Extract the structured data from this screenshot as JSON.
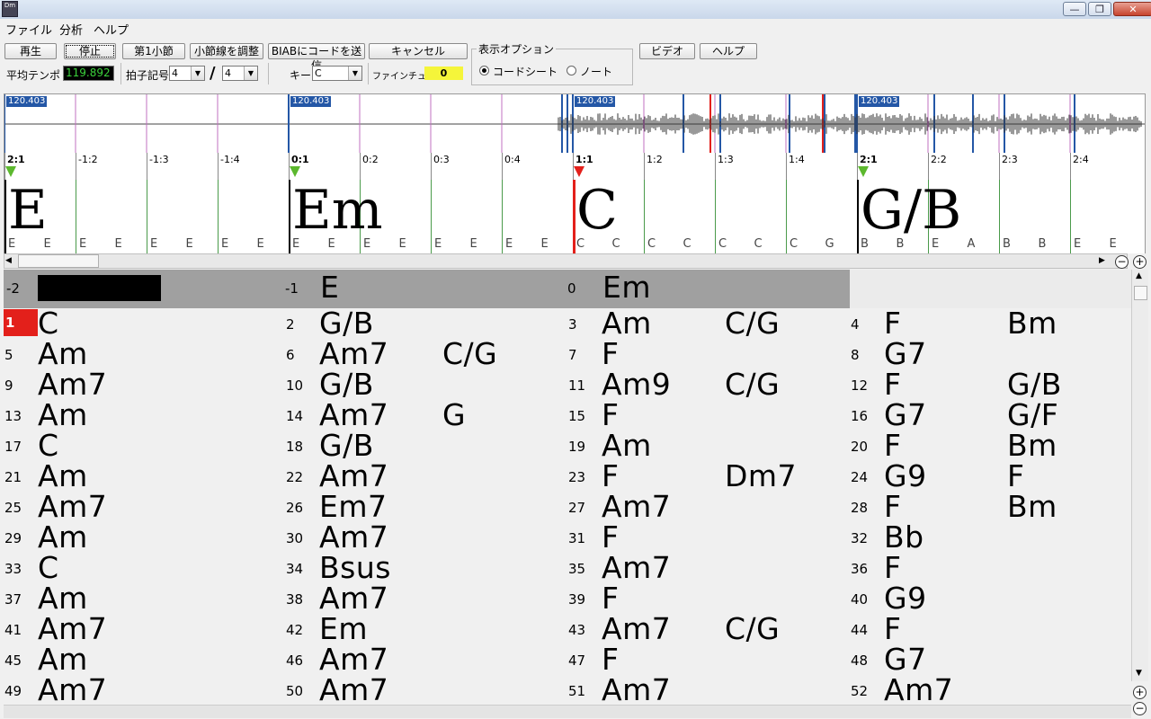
{
  "window": {
    "icon_label": "Dm",
    "minimize": "—",
    "restore": "❐",
    "close": "✕"
  },
  "menu": [
    "ファイル",
    "分析",
    "ヘルプ"
  ],
  "toolbar": {
    "play": "再生",
    "stop": "停止",
    "first_bar": "第1小節",
    "adjust_bars": "小節線を調整",
    "send_chords": "BIABにコードを送信",
    "cancel": "キャンセル",
    "video": "ビデオ",
    "help": "ヘルプ",
    "avg_tempo_label": "平均テンポ",
    "avg_tempo_value": "119.892",
    "time_sig_label": "拍子記号",
    "time_sig_num": "4",
    "time_sig_den": "4",
    "slash": "/",
    "key_label": "キー",
    "key_value": "C",
    "finetune_label": "ファインチューン",
    "finetune_value": "0",
    "display_options_title": "表示オプション",
    "opt_chordsheet": "コードシート",
    "opt_notes": "ノート"
  },
  "waveform": {
    "tempo_tags": [
      "120.403",
      "120.403",
      "120.403",
      "120.403"
    ]
  },
  "ruler": {
    "labels": [
      "2:1",
      "-1:2",
      "-1:3",
      "-1:4",
      "0:1",
      "0:2",
      "0:3",
      "0:4",
      "1:1",
      "1:2",
      "1:3",
      "1:4",
      "2:1",
      "2:2",
      "2:3",
      "2:4"
    ]
  },
  "strip": {
    "big_chords": [
      "E",
      "Em",
      "C",
      "G/B"
    ],
    "beat_chords": [
      "E",
      "E",
      "E",
      "E",
      "E",
      "E",
      "E",
      "E",
      "E",
      "E",
      "E",
      "E",
      "E",
      "E",
      "E",
      "E",
      "C",
      "C",
      "C",
      "C",
      "C",
      "C",
      "C",
      "G",
      "B",
      "B",
      "E",
      "A",
      "B",
      "B",
      "E",
      "E"
    ]
  },
  "pre_bars": [
    {
      "num": "-2",
      "chord": ""
    },
    {
      "num": "-1",
      "chord": "E"
    },
    {
      "num": "0",
      "chord": "Em"
    }
  ],
  "bars": [
    {
      "n": "1",
      "c1": "C",
      "c2": ""
    },
    {
      "n": "2",
      "c1": "G/B",
      "c2": ""
    },
    {
      "n": "3",
      "c1": "Am",
      "c2": "C/G"
    },
    {
      "n": "4",
      "c1": "F",
      "c2": "Bm"
    },
    {
      "n": "5",
      "c1": "Am",
      "c2": ""
    },
    {
      "n": "6",
      "c1": "Am7",
      "c2": "C/G"
    },
    {
      "n": "7",
      "c1": "F",
      "c2": ""
    },
    {
      "n": "8",
      "c1": "G7",
      "c2": ""
    },
    {
      "n": "9",
      "c1": "Am7",
      "c2": ""
    },
    {
      "n": "10",
      "c1": "G/B",
      "c2": ""
    },
    {
      "n": "11",
      "c1": "Am9",
      "c2": "C/G"
    },
    {
      "n": "12",
      "c1": "F",
      "c2": "G/B"
    },
    {
      "n": "13",
      "c1": "Am",
      "c2": ""
    },
    {
      "n": "14",
      "c1": "Am7",
      "c2": "G"
    },
    {
      "n": "15",
      "c1": "F",
      "c2": ""
    },
    {
      "n": "16",
      "c1": "G7",
      "c2": "G/F"
    },
    {
      "n": "17",
      "c1": "C",
      "c2": ""
    },
    {
      "n": "18",
      "c1": "G/B",
      "c2": ""
    },
    {
      "n": "19",
      "c1": "Am",
      "c2": ""
    },
    {
      "n": "20",
      "c1": "F",
      "c2": "Bm"
    },
    {
      "n": "21",
      "c1": "Am",
      "c2": ""
    },
    {
      "n": "22",
      "c1": "Am7",
      "c2": ""
    },
    {
      "n": "23",
      "c1": "F",
      "c2": "Dm7"
    },
    {
      "n": "24",
      "c1": "G9",
      "c2": "F"
    },
    {
      "n": "25",
      "c1": "Am7",
      "c2": ""
    },
    {
      "n": "26",
      "c1": "Em7",
      "c2": ""
    },
    {
      "n": "27",
      "c1": "Am7",
      "c2": ""
    },
    {
      "n": "28",
      "c1": "F",
      "c2": "Bm"
    },
    {
      "n": "29",
      "c1": "Am",
      "c2": ""
    },
    {
      "n": "30",
      "c1": "Am7",
      "c2": ""
    },
    {
      "n": "31",
      "c1": "F",
      "c2": ""
    },
    {
      "n": "32",
      "c1": "Bb",
      "c2": ""
    },
    {
      "n": "33",
      "c1": "C",
      "c2": ""
    },
    {
      "n": "34",
      "c1": "Bsus",
      "c2": ""
    },
    {
      "n": "35",
      "c1": "Am7",
      "c2": ""
    },
    {
      "n": "36",
      "c1": "F",
      "c2": ""
    },
    {
      "n": "37",
      "c1": "Am",
      "c2": ""
    },
    {
      "n": "38",
      "c1": "Am7",
      "c2": ""
    },
    {
      "n": "39",
      "c1": "F",
      "c2": ""
    },
    {
      "n": "40",
      "c1": "G9",
      "c2": ""
    },
    {
      "n": "41",
      "c1": "Am7",
      "c2": ""
    },
    {
      "n": "42",
      "c1": "Em",
      "c2": ""
    },
    {
      "n": "43",
      "c1": "Am7",
      "c2": "C/G"
    },
    {
      "n": "44",
      "c1": "F",
      "c2": ""
    },
    {
      "n": "45",
      "c1": "Am",
      "c2": ""
    },
    {
      "n": "46",
      "c1": "Am7",
      "c2": ""
    },
    {
      "n": "47",
      "c1": "F",
      "c2": ""
    },
    {
      "n": "48",
      "c1": "G7",
      "c2": ""
    },
    {
      "n": "49",
      "c1": "Am7",
      "c2": ""
    },
    {
      "n": "50",
      "c1": "Am7",
      "c2": ""
    },
    {
      "n": "51",
      "c1": "Am7",
      "c2": ""
    },
    {
      "n": "52",
      "c1": "Am7",
      "c2": ""
    }
  ],
  "colors": {
    "current_bar": "#e3201b",
    "pre_bar_bg": "#a0a0a0",
    "tempo_tag": "#2457a6",
    "marker_green": "#5cb82e",
    "marker_red": "#e3201b"
  }
}
